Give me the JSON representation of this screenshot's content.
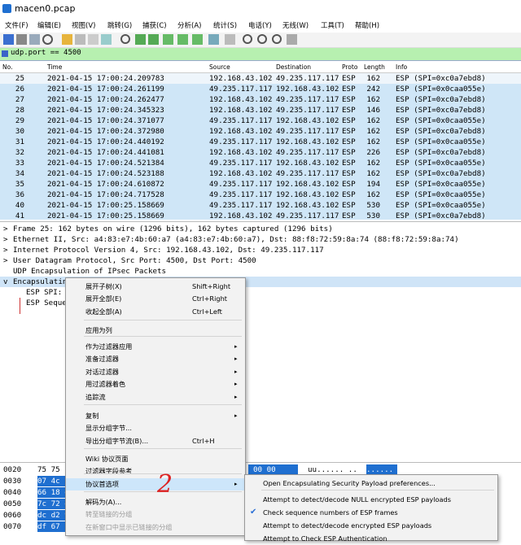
{
  "window": {
    "title": "macen0.pcap"
  },
  "menubar": [
    "文件(F)",
    "编辑(E)",
    "视图(V)",
    "跳转(G)",
    "捕获(C)",
    "分析(A)",
    "统计(S)",
    "电话(Y)",
    "无线(W)",
    "工具(T)",
    "帮助(H)"
  ],
  "filter": {
    "value": "udp.port == 4500"
  },
  "columns": [
    "No.",
    "Time",
    "Source",
    "Destination",
    "Protocol",
    "Length",
    "Info"
  ],
  "columns_short": {
    "proto": "Proto",
    "length": "Length"
  },
  "packets": [
    {
      "no": "25",
      "time": "2021-04-15 17:00:24.209783",
      "src": "192.168.43.102",
      "dst": "49.235.117.117",
      "proto": "ESP",
      "len": "162",
      "info": "ESP (SPI=0xc0a7ebd8)"
    },
    {
      "no": "26",
      "time": "2021-04-15 17:00:24.261199",
      "src": "49.235.117.117",
      "dst": "192.168.43.102",
      "proto": "ESP",
      "len": "242",
      "info": "ESP (SPI=0x0caa055e)"
    },
    {
      "no": "27",
      "time": "2021-04-15 17:00:24.262477",
      "src": "192.168.43.102",
      "dst": "49.235.117.117",
      "proto": "ESP",
      "len": "162",
      "info": "ESP (SPI=0xc0a7ebd8)"
    },
    {
      "no": "28",
      "time": "2021-04-15 17:00:24.345323",
      "src": "192.168.43.102",
      "dst": "49.235.117.117",
      "proto": "ESP",
      "len": "146",
      "info": "ESP (SPI=0xc0a7ebd8)"
    },
    {
      "no": "29",
      "time": "2021-04-15 17:00:24.371077",
      "src": "49.235.117.117",
      "dst": "192.168.43.102",
      "proto": "ESP",
      "len": "162",
      "info": "ESP (SPI=0x0caa055e)"
    },
    {
      "no": "30",
      "time": "2021-04-15 17:00:24.372980",
      "src": "192.168.43.102",
      "dst": "49.235.117.117",
      "proto": "ESP",
      "len": "162",
      "info": "ESP (SPI=0xc0a7ebd8)"
    },
    {
      "no": "31",
      "time": "2021-04-15 17:00:24.440192",
      "src": "49.235.117.117",
      "dst": "192.168.43.102",
      "proto": "ESP",
      "len": "162",
      "info": "ESP (SPI=0x0caa055e)"
    },
    {
      "no": "32",
      "time": "2021-04-15 17:00:24.441081",
      "src": "192.168.43.102",
      "dst": "49.235.117.117",
      "proto": "ESP",
      "len": "226",
      "info": "ESP (SPI=0xc0a7ebd8)"
    },
    {
      "no": "33",
      "time": "2021-04-15 17:00:24.521384",
      "src": "49.235.117.117",
      "dst": "192.168.43.102",
      "proto": "ESP",
      "len": "162",
      "info": "ESP (SPI=0x0caa055e)"
    },
    {
      "no": "34",
      "time": "2021-04-15 17:00:24.523188",
      "src": "192.168.43.102",
      "dst": "49.235.117.117",
      "proto": "ESP",
      "len": "162",
      "info": "ESP (SPI=0xc0a7ebd8)"
    },
    {
      "no": "35",
      "time": "2021-04-15 17:00:24.610872",
      "src": "49.235.117.117",
      "dst": "192.168.43.102",
      "proto": "ESP",
      "len": "194",
      "info": "ESP (SPI=0x0caa055e)"
    },
    {
      "no": "36",
      "time": "2021-04-15 17:00:24.717528",
      "src": "49.235.117.117",
      "dst": "192.168.43.102",
      "proto": "ESP",
      "len": "162",
      "info": "ESP (SPI=0x0caa055e)"
    },
    {
      "no": "40",
      "time": "2021-04-15 17:00:25.158669",
      "src": "49.235.117.117",
      "dst": "192.168.43.102",
      "proto": "ESP",
      "len": "530",
      "info": "ESP (SPI=0x0caa055e)"
    },
    {
      "no": "41",
      "time": "2021-04-15 17:00:25.158669",
      "src": "192.168.43.102",
      "dst": "49.235.117.117",
      "proto": "ESP",
      "len": "530",
      "info": "ESP (SPI=0xc0a7ebd8)"
    }
  ],
  "details": [
    {
      "arrow": ">",
      "text": "Frame 25: 162 bytes on wire (1296 bits), 162 bytes captured (1296 bits)"
    },
    {
      "arrow": ">",
      "text": "Ethernet II, Src: a4:83:e7:4b:60:a7 (a4:83:e7:4b:60:a7), Dst: 88:f8:72:59:8a:74 (88:f8:72:59:8a:74)"
    },
    {
      "arrow": ">",
      "text": "Internet Protocol Version 4, Src: 192.168.43.102, Dst: 49.235.117.117"
    },
    {
      "arrow": ">",
      "text": "User Datagram Protocol, Src Port: 4500, Dst Port: 4500"
    },
    {
      "arrow": "",
      "text": "UDP Encapsulation of IPsec Packets"
    },
    {
      "arrow": "v",
      "text": "Encapsulating"
    }
  ],
  "details_children": [
    "ESP SPI: (",
    "ESP Sequen"
  ],
  "bytes": [
    {
      "off": "0020",
      "hex": "75 75 1",
      "tail": "00 00",
      "ascii": "uu...... ..",
      "ascii_sel": "......"
    },
    {
      "off": "0030",
      "hex": "07 4c 1"
    },
    {
      "off": "0040",
      "hex": "66 18 e"
    },
    {
      "off": "0050",
      "hex": "7c 72 e"
    },
    {
      "off": "0060",
      "hex": "dc d2 9"
    },
    {
      "off": "0070",
      "hex": "df 67 b"
    }
  ],
  "context_menu": {
    "items": [
      {
        "label": "展开子树(X)",
        "shortcut": "Shift+Right"
      },
      {
        "label": "展开全部(E)",
        "shortcut": "Ctrl+Right"
      },
      {
        "label": "收起全部(A)",
        "shortcut": "Ctrl+Left"
      },
      {
        "label": "应用为列"
      },
      {
        "label": "作为过滤器应用",
        "sub": "▸"
      },
      {
        "label": "准备过滤器",
        "sub": "▸"
      },
      {
        "label": "对话过滤器",
        "sub": "▸"
      },
      {
        "label": "用过滤器着色",
        "sub": "▸"
      },
      {
        "label": "追踪流",
        "sub": "▸"
      },
      {
        "label": "复制",
        "sub": "▸"
      },
      {
        "label": "显示分组字节..."
      },
      {
        "label": "导出分组字节流(B)...",
        "shortcut": "Ctrl+H"
      },
      {
        "label": "Wiki 协议页面"
      },
      {
        "label": "过滤器字段参考"
      },
      {
        "label": "协议首选项",
        "sub": "▸"
      },
      {
        "label": "解码为(A)..."
      },
      {
        "label": "转至链接的分组"
      },
      {
        "label": "在新窗口中显示已链接的分组"
      }
    ]
  },
  "submenu": {
    "items": [
      {
        "label": "Open Encapsulating Security Payload preferences...",
        "checked": false
      },
      {
        "label": "Attempt to detect/decode NULL encrypted ESP payloads",
        "checked": false
      },
      {
        "label": "Check sequence numbers of ESP frames",
        "checked": true
      },
      {
        "label": "Attempt to detect/decode encrypted ESP payloads",
        "checked": false
      },
      {
        "label": "Attempt to Check ESP Authentication",
        "checked": false
      }
    ],
    "check_glyph": "✔"
  },
  "annotation": "2",
  "colors": {
    "row_bg": "#cfe6f7",
    "filter_bg": "#b7f0b0",
    "hover_bg": "#cde6fa",
    "annotation": "#d22"
  }
}
